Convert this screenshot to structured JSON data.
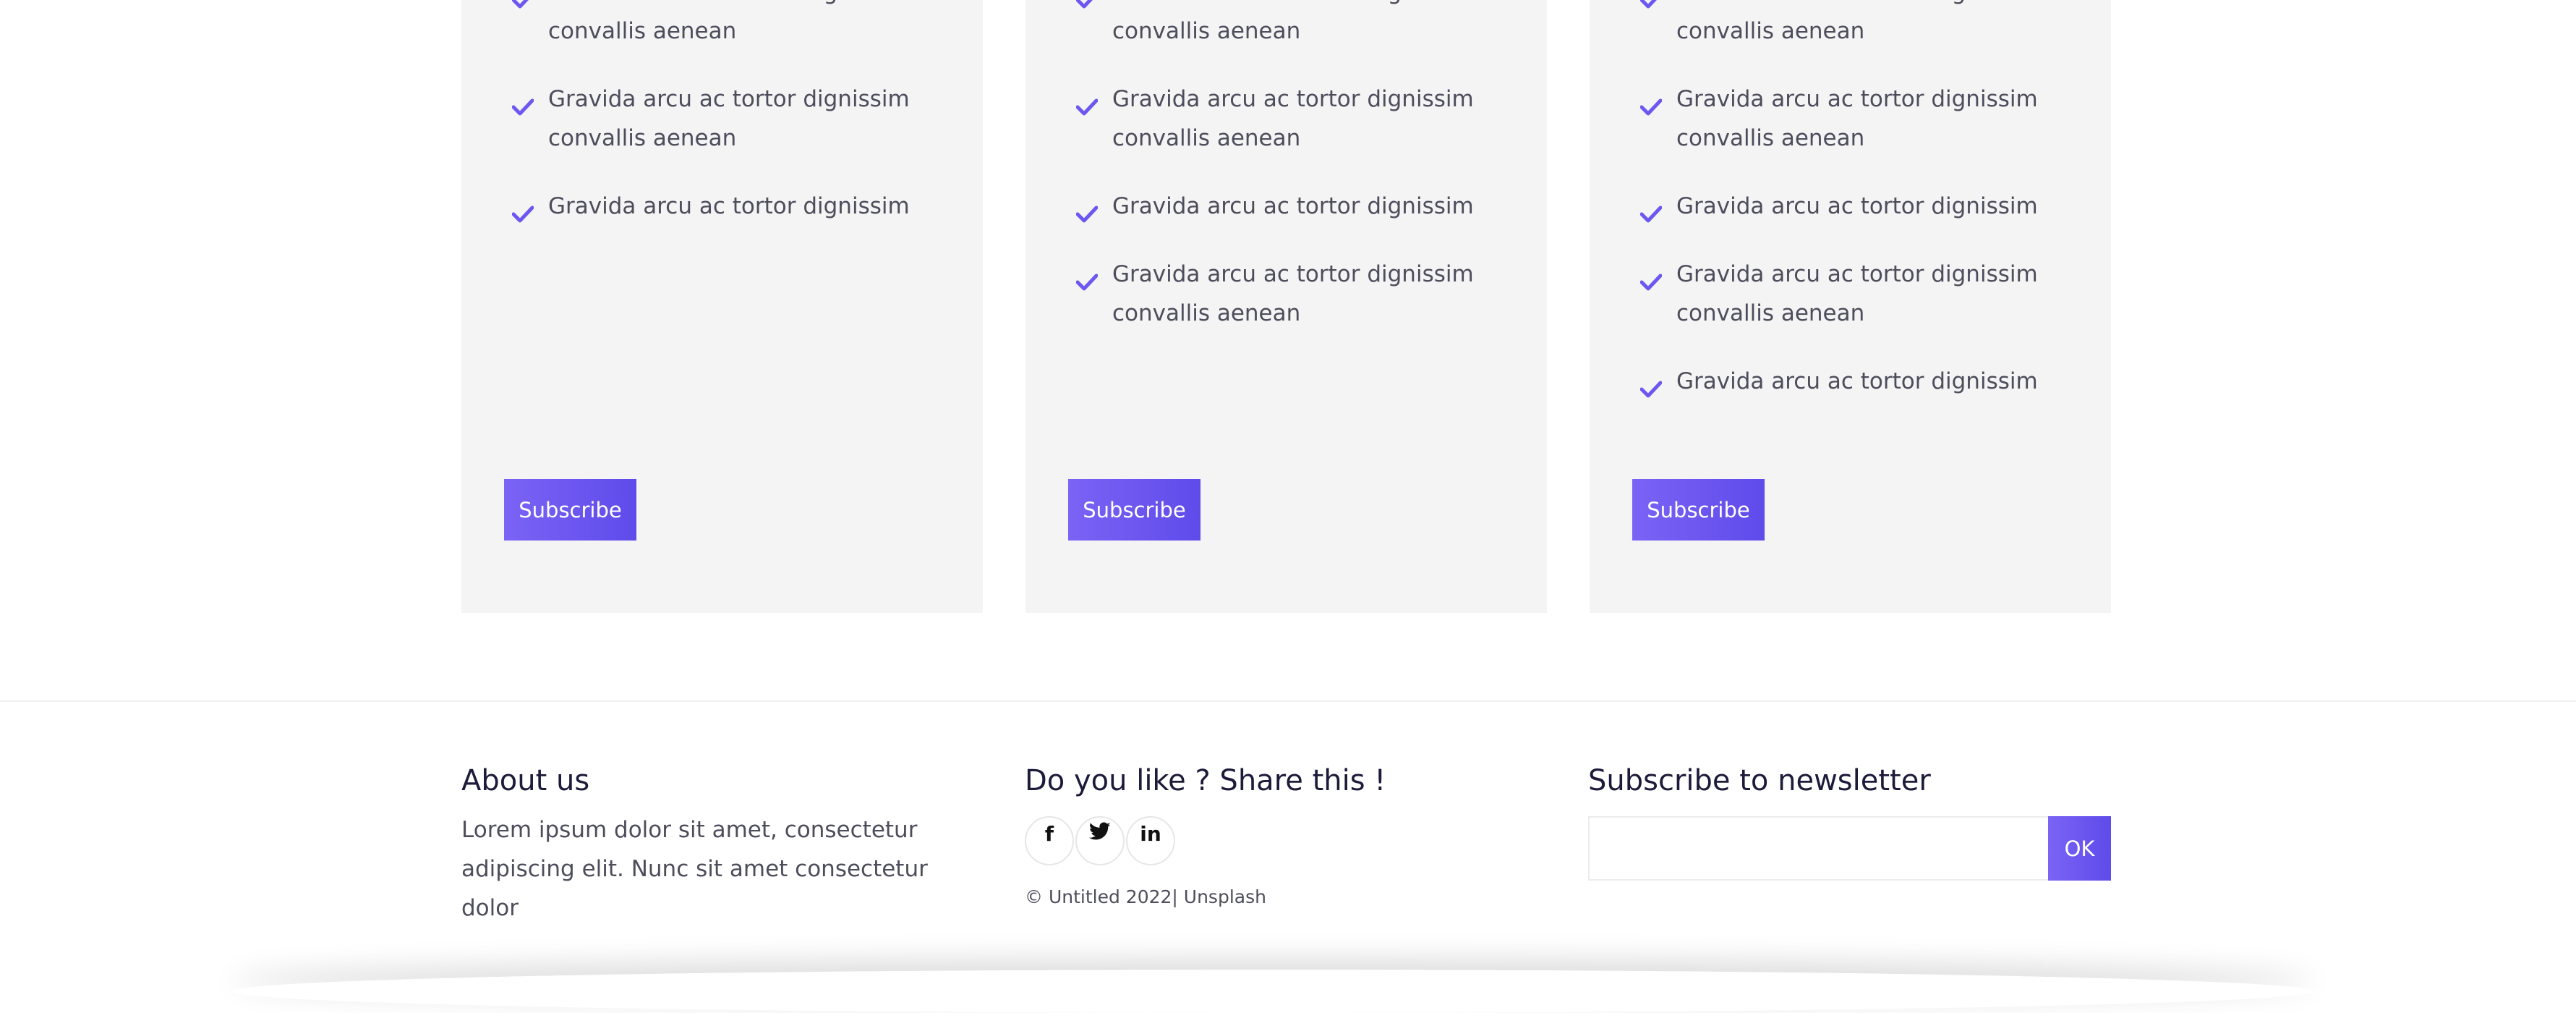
{
  "colors": {
    "accent": "#6c57f0",
    "card_bg": "#f4f4f5",
    "heading": "#1d1b3a",
    "text": "#4d4d5c"
  },
  "cards": [
    {
      "features": [
        "Gravida arcu ac tortor dignissim convallis aenean",
        "Gravida arcu ac tortor dignissim convallis aenean",
        "Gravida arcu ac tortor dignissim"
      ],
      "button_label": "Subscribe"
    },
    {
      "features": [
        "Gravida arcu ac tortor dignissim convallis aenean",
        "Gravida arcu ac tortor dignissim convallis aenean",
        "Gravida arcu ac tortor dignissim",
        "Gravida arcu ac tortor dignissim convallis aenean"
      ],
      "button_label": "Subscribe"
    },
    {
      "features": [
        "Gravida arcu ac tortor dignissim convallis aenean",
        "Gravida arcu ac tortor dignissim convallis aenean",
        "Gravida arcu ac tortor dignissim",
        "Gravida arcu ac tortor dignissim convallis aenean",
        "Gravida arcu ac tortor dignissim"
      ],
      "button_label": "Subscribe"
    }
  ],
  "footer": {
    "about": {
      "title": "About us",
      "text": "Lorem ipsum dolor sit amet, consectetur adipiscing elit. Nunc sit amet consectetur dolor"
    },
    "share": {
      "title": "Do you like ? Share this !",
      "social": [
        {
          "icon": "facebook-icon",
          "glyph": "f"
        },
        {
          "icon": "twitter-icon",
          "glyph": ""
        },
        {
          "icon": "linkedin-icon",
          "glyph": "in"
        }
      ],
      "copyright": "© Untitled 2022| Unsplash"
    },
    "newsletter": {
      "title": "Subscribe to newsletter",
      "input_value": "",
      "input_placeholder": "",
      "button_label": "OK"
    }
  }
}
